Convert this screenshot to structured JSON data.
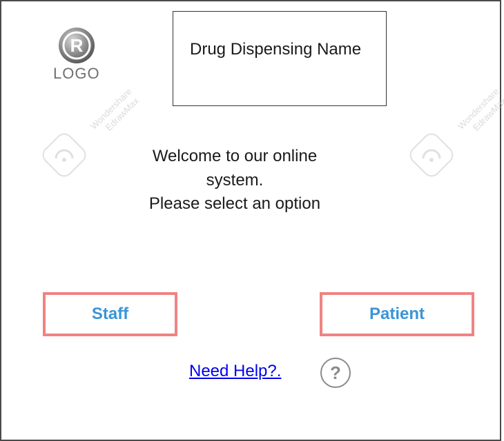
{
  "logo": {
    "mark": "R",
    "text": "LOGO"
  },
  "title": {
    "text": "Drug Dispensing Name"
  },
  "welcome": {
    "line1": "Welcome to our online",
    "line2": "system.",
    "line3": "Please select an option"
  },
  "buttons": {
    "staff_label": "Staff",
    "patient_label": "Patient"
  },
  "help": {
    "link_text": "Need Help?.",
    "icon_glyph": "?"
  },
  "watermark": {
    "line1": "Wondershare",
    "line2": "EdrawMax"
  },
  "colors": {
    "button_border": "#f18282",
    "button_text": "#3a95d6",
    "link": "#0000ee"
  },
  "icons": {
    "logo": "registered-mark-icon",
    "help": "question-circle-icon",
    "watermark": "edrawmax-logo-icon"
  }
}
